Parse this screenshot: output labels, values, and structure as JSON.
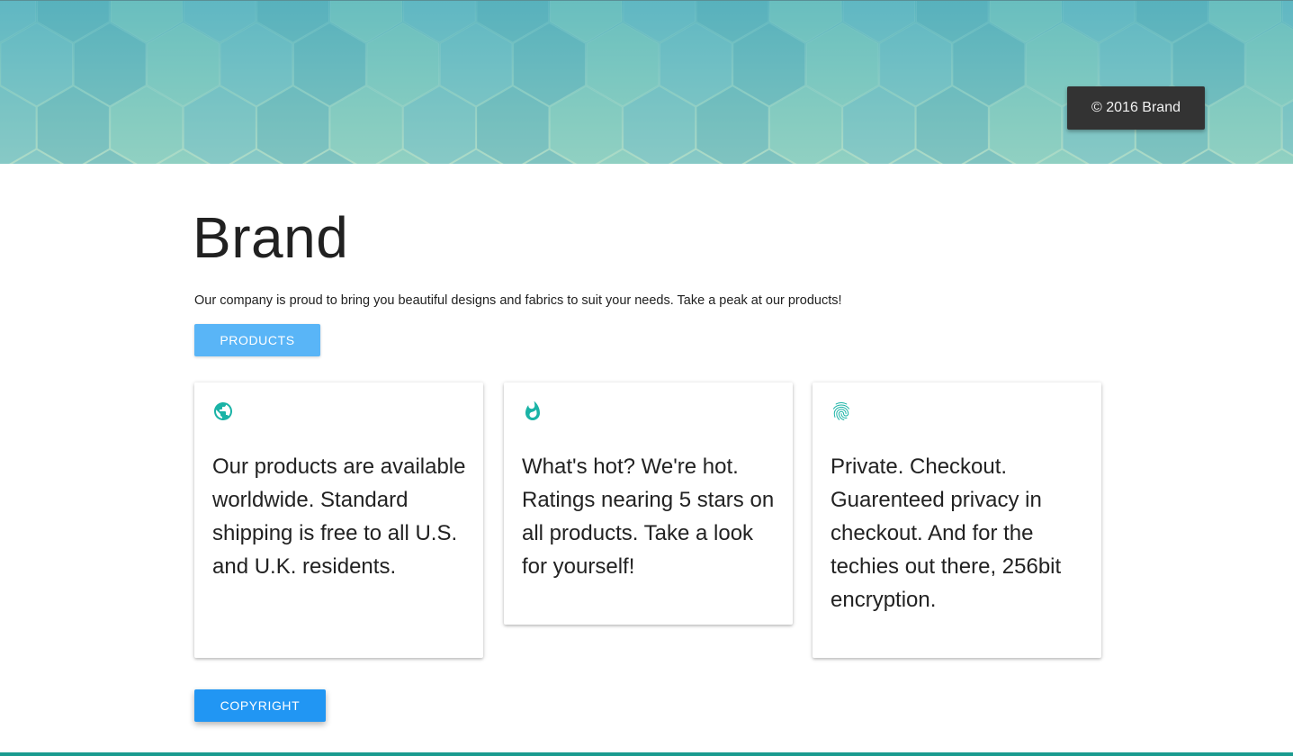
{
  "header": {
    "badge_text": "© 2016 Brand"
  },
  "main": {
    "title": "Brand",
    "intro": "Our company is proud to bring you beautiful designs and fabrics to suit your needs. Take a peak at our products!",
    "products_button": "PRODUCTS",
    "copyright_button": "COPYRIGHT"
  },
  "cards": [
    {
      "icon": "globe-icon",
      "text": "Our products are available worldwide. Standard shipping is free to all U.S. and U.K. residents."
    },
    {
      "icon": "flame-icon",
      "text": "What's hot? We're hot. Ratings nearing 5 stars on all products. Take a look for yourself!"
    },
    {
      "icon": "fingerprint-icon",
      "text": "Private. Checkout. Guarenteed privacy in checkout. And for the techies out there, 256bit encryption."
    }
  ],
  "colors": {
    "accent_teal": "#1ab3a6",
    "products_button": "#59b5f7",
    "copyright_button": "#2196f3",
    "badge_background": "#333333",
    "footer_bar": "#1a9b8f"
  }
}
